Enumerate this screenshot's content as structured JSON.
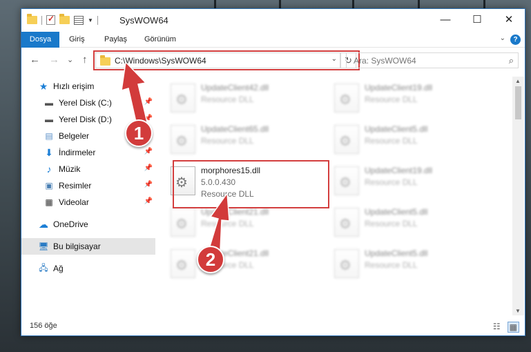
{
  "window": {
    "title": "SysWOW64",
    "minimize": "—",
    "maximize": "☐",
    "close": "✕"
  },
  "ribbon": {
    "tabs": [
      "Dosya",
      "Giriş",
      "Paylaş",
      "Görünüm"
    ],
    "help": "?"
  },
  "navigation": {
    "back": "←",
    "forward": "→",
    "recent": "⌄",
    "up": "↑",
    "path": "C:\\Windows\\SysWOW64",
    "refresh": "↻",
    "search_placeholder": "Ara: SysWOW64"
  },
  "sidebar": {
    "items": [
      {
        "label": "Hızlı erişim",
        "icon": "star-icon"
      },
      {
        "label": "Yerel Disk (C:)",
        "icon": "drive-icon",
        "pinned": true
      },
      {
        "label": "Yerel Disk (D:)",
        "icon": "drive-icon",
        "pinned": true
      },
      {
        "label": "Belgeler",
        "icon": "documents-icon",
        "pinned": true
      },
      {
        "label": "İndirmeler",
        "icon": "downloads-icon",
        "pinned": true
      },
      {
        "label": "Müzik",
        "icon": "music-icon",
        "pinned": true
      },
      {
        "label": "Resimler",
        "icon": "pictures-icon",
        "pinned": true
      },
      {
        "label": "Videolar",
        "icon": "videos-icon",
        "pinned": true
      },
      {
        "label": "OneDrive",
        "icon": "onedrive-icon"
      },
      {
        "label": "Bu bilgisayar",
        "icon": "computer-icon",
        "selected": true
      },
      {
        "label": "Ağ",
        "icon": "network-icon"
      }
    ]
  },
  "files": [
    {
      "name": "UpdateClient42.dll",
      "type": "Resource DLL"
    },
    {
      "name": "UpdateClient19.dll",
      "type": "Resource DLL"
    },
    {
      "name": "UpdateClient65.dll",
      "type": "Resource DLL"
    },
    {
      "name": "UpdateClient5.dll",
      "type": "Resource DLL"
    },
    {
      "name": "morphores15.dll",
      "version": "5.0.0.430",
      "type": "Resource DLL"
    },
    {
      "name": "UpdateClient19.dll",
      "type": "Resource DLL"
    },
    {
      "name": "UpdateClient21.dll",
      "type": "Resource DLL"
    },
    {
      "name": "UpdateClient5.dll",
      "type": "Resource DLL"
    },
    {
      "name": "UpdateClient21.dll",
      "type": "Resource DLL"
    },
    {
      "name": "UpdateClient5.dll",
      "type": "Resource DLL"
    }
  ],
  "status": {
    "item_count": "156 öğe"
  },
  "annotations": {
    "step1": "1",
    "step2": "2",
    "highlight_color": "#d33e3e"
  },
  "colors": {
    "accent": "#1979ca"
  }
}
